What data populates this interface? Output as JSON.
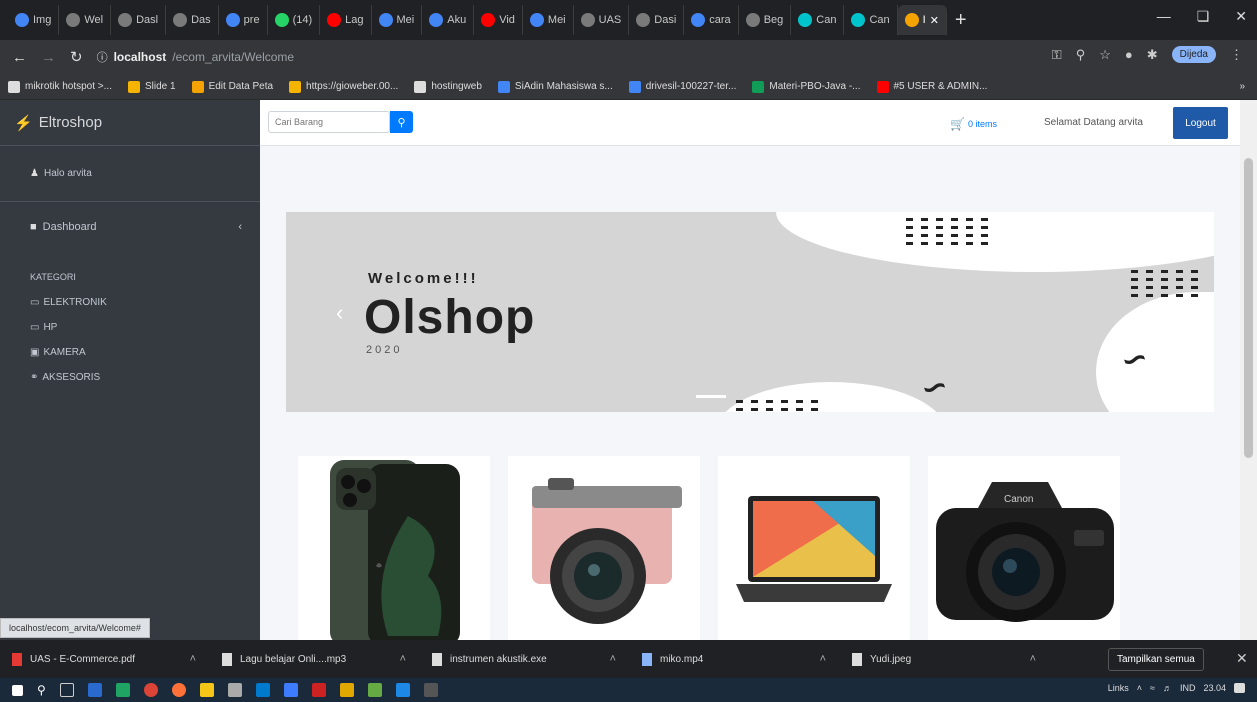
{
  "browser": {
    "tabs": [
      {
        "label": "Img",
        "color": "#4285f4"
      },
      {
        "label": "Wel",
        "color": "#7a7a7a"
      },
      {
        "label": "Dasl",
        "color": "#7a7a7a"
      },
      {
        "label": "Das",
        "color": "#7a7a7a"
      },
      {
        "label": "pre",
        "color": "#4285f4"
      },
      {
        "label": "(14)",
        "color": "#25d366"
      },
      {
        "label": "Lag",
        "color": "#ff0000"
      },
      {
        "label": "Mei",
        "color": "#4285f4"
      },
      {
        "label": "Aku",
        "color": "#4285f4"
      },
      {
        "label": "Vid",
        "color": "#ff0000"
      },
      {
        "label": "Mei",
        "color": "#4285f4"
      },
      {
        "label": "UAS",
        "color": "#7a7a7a"
      },
      {
        "label": "Dasi",
        "color": "#7a7a7a"
      },
      {
        "label": "cara",
        "color": "#4285f4"
      },
      {
        "label": "Beg",
        "color": "#7a7a7a"
      },
      {
        "label": "Can",
        "color": "#00c4cc"
      },
      {
        "label": "Can",
        "color": "#00c4cc"
      },
      {
        "label": "I",
        "color": "#f4a300",
        "active": true
      }
    ],
    "url_host": "localhost",
    "url_path": "/ecom_arvita/Welcome",
    "profile_label": "Dijeda",
    "bookmarks": [
      {
        "label": "mikrotik hotspot >...",
        "color": "#ddd"
      },
      {
        "label": "Slide 1",
        "color": "#f4b400"
      },
      {
        "label": "Edit Data Peta",
        "color": "#f4a300"
      },
      {
        "label": "https://gioweber.00...",
        "color": "#f4b400"
      },
      {
        "label": "hostingweb",
        "color": "#ddd"
      },
      {
        "label": "SiAdin Mahasiswa s...",
        "color": "#4285f4"
      },
      {
        "label": "drivesil-100227-ter...",
        "color": "#4285f4"
      },
      {
        "label": "Materi-PBO-Java -...",
        "color": "#0f9d58"
      },
      {
        "label": "#5 USER & ADMIN...",
        "color": "#ff0000"
      }
    ]
  },
  "sidebar": {
    "brand": "Eltroshop",
    "user": "Halo arvita",
    "dashboard": "Dashboard",
    "category_heading": "KATEGORI",
    "categories": [
      "ELEKTRONIK",
      "HP",
      "KAMERA",
      "AKSESORIS"
    ]
  },
  "topnav": {
    "search_placeholder": "Cari Barang",
    "cart_label": "0 items",
    "welcome": "Selamat Datang arvita",
    "logout": "Logout"
  },
  "banner": {
    "welcome": "Welcome!!!",
    "title": "Olshop",
    "year": "2020"
  },
  "products": [
    {
      "name": "iPhone 11 Pro Max"
    },
    {
      "name": "Pink mirrorless camera"
    },
    {
      "name": "Laptop"
    },
    {
      "name": "Canon DSLR camera"
    }
  ],
  "status_url": "localhost/ecom_arvita/Welcome#",
  "downloads": [
    {
      "name": "UAS - E-Commerce.pdf",
      "color": "#e53935"
    },
    {
      "name": "Lagu belajar Onli....mp3",
      "color": "#ddd"
    },
    {
      "name": "instrumen akustik.exe",
      "color": "#ddd"
    },
    {
      "name": "miko.mp4",
      "color": "#8ab4f8"
    },
    {
      "name": "Yudi.jpeg",
      "color": "#ddd"
    }
  ],
  "show_all": "Tampilkan semua",
  "taskbar": {
    "tray_text": "Links",
    "lang": "IND",
    "time": "23.04"
  }
}
